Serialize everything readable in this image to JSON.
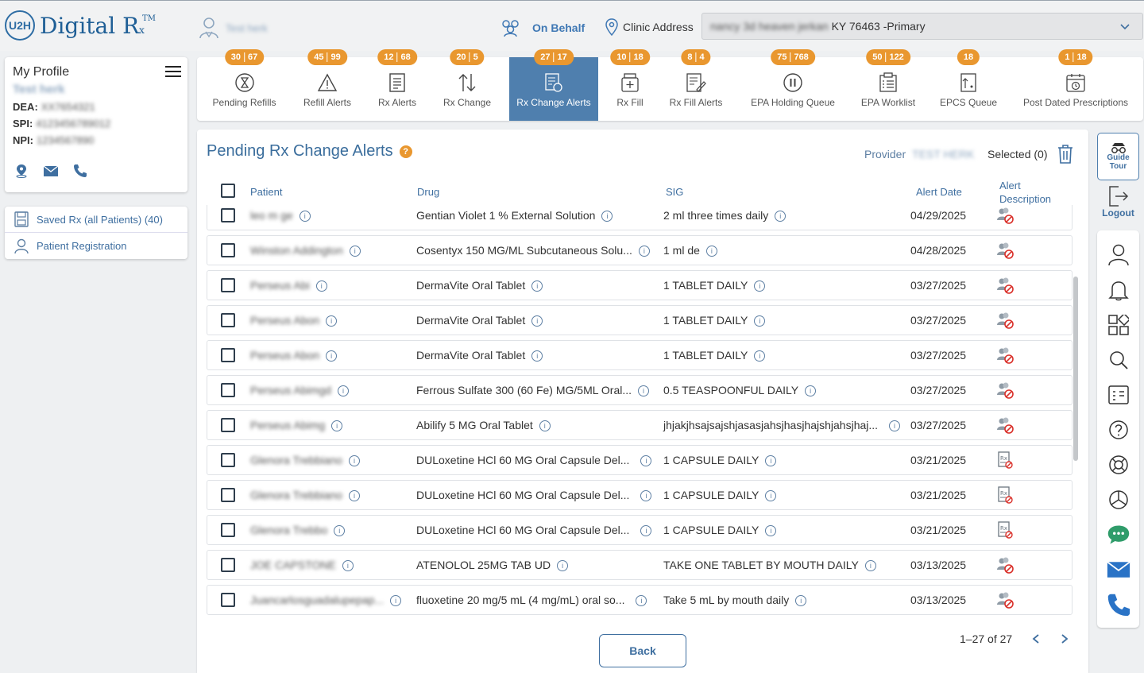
{
  "header": {
    "logo_badge": "U2H",
    "logo_text": "Digital R",
    "logo_sub": "x",
    "logo_tm": "TM",
    "user_name": "Test herk",
    "on_behalf": "On Behalf",
    "clinic_label": "Clinic Address",
    "clinic_value_blur": "nancy 3d heaven jerkan",
    "clinic_value": "KY 76463 -Primary"
  },
  "profile": {
    "title": "My Profile",
    "name": "Test herk",
    "dea_label": "DEA:",
    "dea_value": "XX7654321",
    "spi_label": "SPI:",
    "spi_value": "4123456789012",
    "npi_label": "NPI:",
    "npi_value": "1234567890"
  },
  "side_links": [
    {
      "label": "Saved Rx (all Patients) (40)"
    },
    {
      "label": "Patient Registration"
    }
  ],
  "tabs": [
    {
      "label": "Pending Refills",
      "b1": "30",
      "b2": "67",
      "icon": "hourglass-icon"
    },
    {
      "label": "Refill Alerts",
      "b1": "45",
      "b2": "99",
      "icon": "warning-icon"
    },
    {
      "label": "Rx Alerts",
      "b1": "12",
      "b2": "68",
      "icon": "document-icon"
    },
    {
      "label": "Rx Change",
      "b1": "20",
      "b2": "5",
      "icon": "swap-arrows-icon"
    },
    {
      "label": "Rx Change Alerts",
      "b1": "27",
      "b2": "17",
      "icon": "rx-change-alert-icon"
    },
    {
      "label": "Rx Fill",
      "b1": "10",
      "b2": "18",
      "icon": "pill-bottle-icon"
    },
    {
      "label": "Rx Fill Alerts",
      "b1": "8",
      "b2": "4",
      "icon": "edit-document-icon"
    },
    {
      "label": "EPA Holding Queue",
      "b1": "75",
      "b2": "768",
      "icon": "pause-icon"
    },
    {
      "label": "EPA Worklist",
      "b1": "50",
      "b2": "122",
      "icon": "worklist-icon"
    },
    {
      "label": "EPCS Queue",
      "b1": "18",
      "b2": "",
      "icon": "epcs-icon"
    },
    {
      "label": "Post Dated Prescriptions",
      "b1": "1",
      "b2": "18",
      "icon": "calendar-icon"
    }
  ],
  "main": {
    "title": "Pending Rx Change Alerts",
    "help": "?",
    "provider_label": "Provider",
    "provider_value": "TEST HERK",
    "selected": "Selected (0)",
    "columns": {
      "patient": "Patient",
      "drug": "Drug",
      "sig": "SIG",
      "alert_date": "Alert Date",
      "alert_desc_1": "Alert",
      "alert_desc_2": "Description"
    },
    "rows": [
      {
        "patient": "leo m ge",
        "drug": "Gentian Violet 1 % External Solution",
        "sig": "2 ml three times daily",
        "date": "04/29/2025",
        "alert": "patient-alert-icon"
      },
      {
        "patient": "Winston Addington",
        "drug": "Cosentyx 150 MG/ML Subcutaneous Solu...",
        "sig": "1 ml de",
        "date": "04/28/2025",
        "alert": "patient-alert-icon"
      },
      {
        "patient": "Perseus Abi",
        "drug": "DermaVite Oral Tablet",
        "sig": "1 TABLET DAILY",
        "date": "03/27/2025",
        "alert": "patient-alert-icon"
      },
      {
        "patient": "Perseus Abon",
        "drug": "DermaVite Oral Tablet",
        "sig": "1 TABLET DAILY",
        "date": "03/27/2025",
        "alert": "patient-alert-icon"
      },
      {
        "patient": "Perseus Abon",
        "drug": "DermaVite Oral Tablet",
        "sig": "1 TABLET DAILY",
        "date": "03/27/2025",
        "alert": "patient-alert-icon"
      },
      {
        "patient": "Perseus Abimgd",
        "drug": "Ferrous Sulfate 300 (60 Fe) MG/5ML Oral...",
        "sig": "0.5 TEASPOONFUL DAILY",
        "date": "03/27/2025",
        "alert": "patient-alert-icon"
      },
      {
        "patient": "Perseus Abimg",
        "drug": "Abilify 5 MG Oral Tablet",
        "sig": "jhjakjhsajsajshjasasjahsjhasjhajshjahsjhaj...",
        "date": "03/27/2025",
        "alert": "patient-alert-icon"
      },
      {
        "patient": "Glenora Trebbiano",
        "drug": "DULoxetine HCl 60 MG Oral Capsule Del...",
        "sig": "1 CAPSULE DAILY",
        "date": "03/21/2025",
        "alert": "rx-document-alert-icon"
      },
      {
        "patient": "Glenora Trebbiano",
        "drug": "DULoxetine HCl 60 MG Oral Capsule Del...",
        "sig": "1 CAPSULE DAILY",
        "date": "03/21/2025",
        "alert": "rx-document-alert-icon"
      },
      {
        "patient": "Glenora Trebbo",
        "drug": "DULoxetine HCl 60 MG Oral Capsule Del...",
        "sig": "1 CAPSULE DAILY",
        "date": "03/21/2025",
        "alert": "rx-document-alert-icon"
      },
      {
        "patient": "JOE CAPSTONE",
        "drug": "ATENOLOL 25MG TAB UD",
        "sig": "TAKE ONE TABLET BY MOUTH DAILY",
        "date": "03/13/2025",
        "alert": "patient-alert-icon"
      },
      {
        "patient": "Juancarlosguadalupepap...",
        "drug": "fluoxetine 20 mg/5 mL (4 mg/mL) oral so...",
        "sig": "Take 5 mL by mouth daily",
        "date": "03/13/2025",
        "alert": "patient-alert-icon"
      }
    ],
    "back": "Back",
    "pager": "1–27 of 27"
  },
  "rail": {
    "guide_1": "Guide",
    "guide_2": "Tour",
    "logout": "Logout"
  },
  "colors": {
    "brand_blue": "#4f7fae",
    "badge_orange": "#e9972f",
    "alert_red": "#d9302a"
  }
}
